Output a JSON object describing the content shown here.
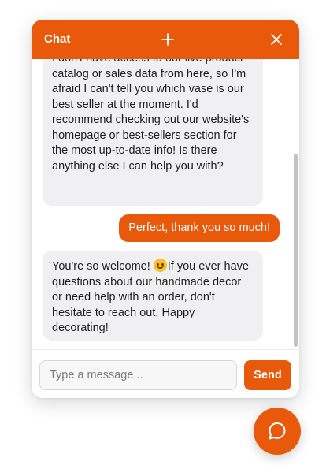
{
  "header": {
    "title": "Chat",
    "new_chat_icon": "plus-icon",
    "close_icon": "close-icon"
  },
  "messages": [
    {
      "role": "assistant",
      "text": "I don't have access to our live product catalog or sales data from here, so I'm afraid I can't tell you which vase is our best seller at the moment. I'd recommend checking out our website's homepage or best-sellers section for the most up-to-date info! Is there anything else I can help you with?"
    },
    {
      "role": "user",
      "text": "Perfect, thank you so much!"
    },
    {
      "role": "assistant",
      "text_before_emoji": "You're so welcome! ",
      "emoji": "smiling-face-emoji",
      "text_after_emoji": "If you ever have questions about our handmade decor or need help with an order, don't hesitate to reach out. Happy decorating!"
    }
  ],
  "composer": {
    "placeholder": "Type a message...",
    "value": "",
    "send_label": "Send"
  },
  "launcher": {
    "icon": "chat-bubble-icon"
  },
  "colors": {
    "accent": "#e8590c",
    "bot_bubble": "#f0f0f2",
    "user_text": "#ffffff"
  }
}
